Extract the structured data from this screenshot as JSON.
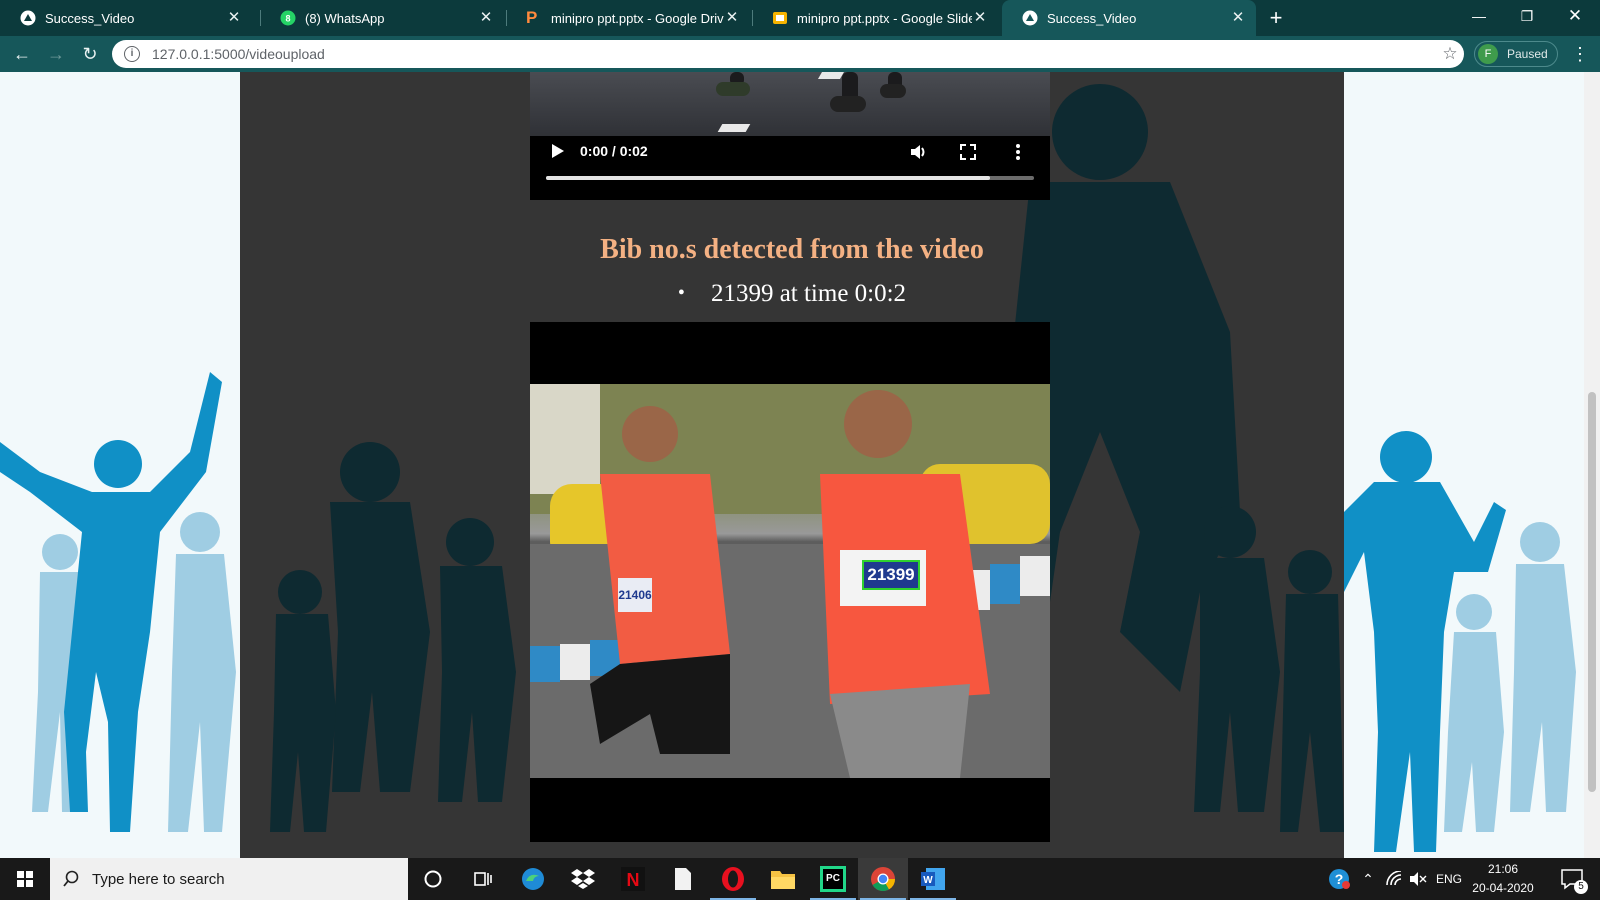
{
  "browser": {
    "tabs": [
      {
        "title": "Success_Video",
        "icon": "flask-globe-icon",
        "active": false
      },
      {
        "title": "(8) WhatsApp",
        "icon": "whatsapp-icon",
        "active": false
      },
      {
        "title": "minipro ppt.pptx - Google Drive",
        "icon": "powerpoint-p-icon",
        "active": false
      },
      {
        "title": "minipro ppt.pptx - Google Slides",
        "icon": "google-slides-icon",
        "active": false
      },
      {
        "title": "Success_Video",
        "icon": "flask-globe-icon",
        "active": true
      }
    ],
    "address": "127.0.0.1:5000/videoupload",
    "profile_initial": "F",
    "profile_status": "Paused",
    "colors": {
      "frame": "#0c3a3c",
      "toolbar": "#16575a"
    }
  },
  "page": {
    "video": {
      "current_time": "0:00",
      "duration": "0:02",
      "time_display": "0:00 / 0:02",
      "progress": 0.91
    },
    "heading": "Bib no.s detected from the video",
    "detections": [
      "21399 at time 0:0:2"
    ],
    "detected_bib": "21399",
    "other_visible_bib": "21406",
    "colors": {
      "heading": "#f4b183",
      "panel": "#353535",
      "box": "#2fd12f"
    }
  },
  "taskbar": {
    "search_placeholder": "Type here to search",
    "apps": [
      "cortana-icon",
      "task-view-icon",
      "edge-icon",
      "dropbox-icon",
      "netflix-icon",
      "file-icon",
      "opera-icon",
      "file-explorer-icon",
      "pycharm-icon",
      "chrome-icon",
      "word-icon"
    ],
    "tray": {
      "language": "ENG",
      "time": "21:06",
      "date": "20-04-2020",
      "notification_count": "5"
    }
  }
}
